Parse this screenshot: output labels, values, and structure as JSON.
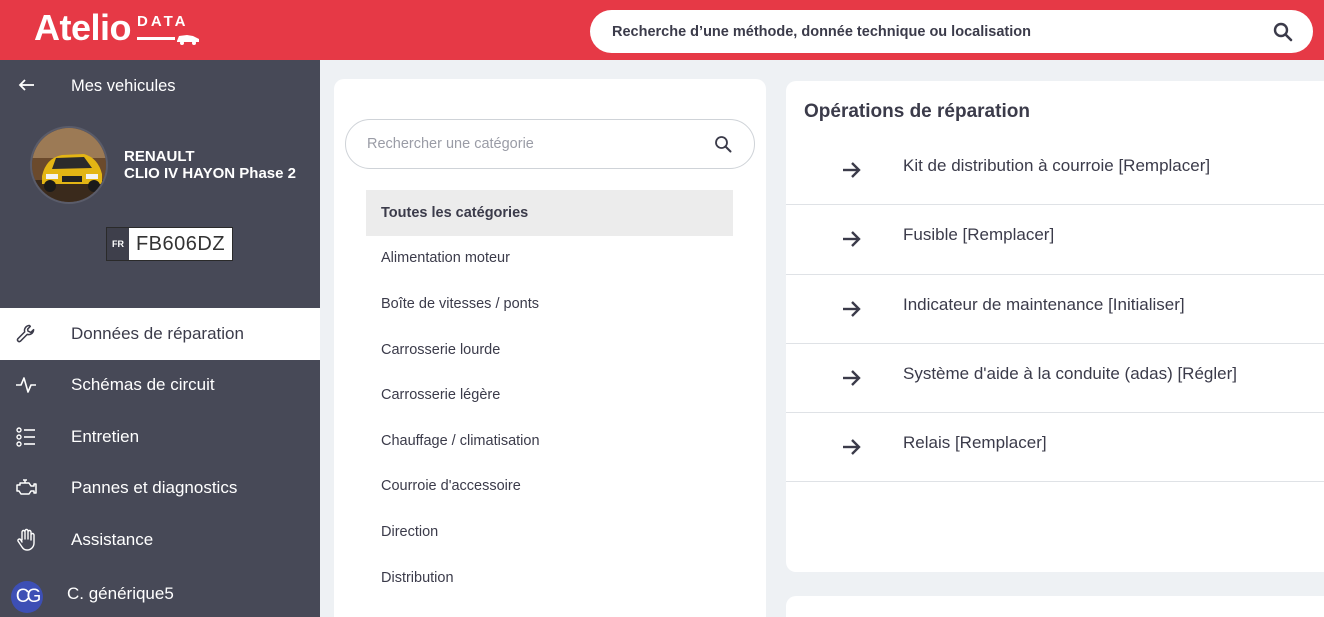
{
  "brand": {
    "name": "Atelio",
    "sub": "DATA"
  },
  "search": {
    "placeholder": "Recherche d’une méthode, donnée technique ou localisation",
    "icon": "search-icon"
  },
  "vehicle": {
    "back_label": "Mes vehicules",
    "make": "RENAULT",
    "model": "CLIO IV HAYON Phase 2",
    "plate_country": "FR",
    "plate_number": "FB606DZ"
  },
  "nav": [
    {
      "label": "Données de réparation",
      "icon": "wrench-icon",
      "active": true
    },
    {
      "label": "Schémas de circuit",
      "icon": "pulse-icon",
      "active": false
    },
    {
      "label": "Entretien",
      "icon": "checklist-icon",
      "active": false
    },
    {
      "label": "Pannes et diagnostics",
      "icon": "engine-icon",
      "active": false
    },
    {
      "label": "Assistance",
      "icon": "hand-icon",
      "active": false
    }
  ],
  "user": {
    "initials": "CG",
    "name": "C. générique5"
  },
  "categories": {
    "placeholder": "Rechercher une catégorie",
    "items": [
      "Toutes les catégories",
      "Alimentation moteur",
      "Boîte de vitesses / ponts",
      "Carrosserie lourde",
      "Carrosserie légère",
      "Chauffage / climatisation",
      "Courroie d'accessoire",
      "Direction",
      "Distribution"
    ]
  },
  "operations": {
    "title": "Opérations de réparation",
    "items": [
      "Kit de distribution à courroie [Remplacer]",
      "Fusible [Remplacer]",
      "Indicateur de maintenance [Initialiser]",
      "Système d'aide à la conduite (adas) [Régler]",
      "Relais [Remplacer]"
    ]
  },
  "colors": {
    "brand_red": "#e63946",
    "sidebar": "#474957",
    "avatar_blue": "#3d4fb5"
  }
}
